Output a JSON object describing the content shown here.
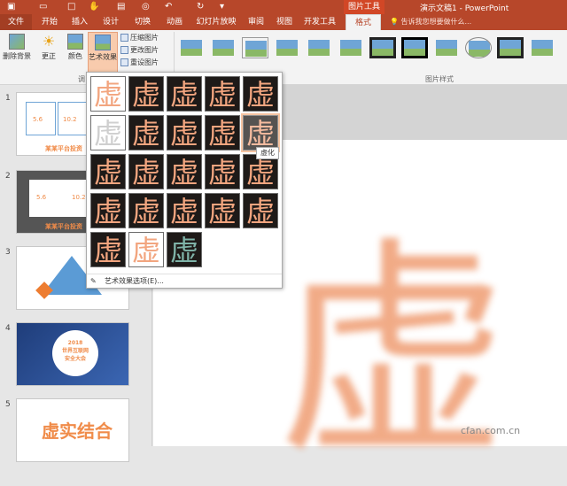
{
  "titlebar": {
    "context_tool": "图片工具",
    "doc_title": "演示文稿1 - PowerPoint"
  },
  "tabs": [
    {
      "label": "文件"
    },
    {
      "label": "开始"
    },
    {
      "label": "插入"
    },
    {
      "label": "设计"
    },
    {
      "label": "切换"
    },
    {
      "label": "动画"
    },
    {
      "label": "幻灯片放映"
    },
    {
      "label": "审阅"
    },
    {
      "label": "视图"
    },
    {
      "label": "开发工具"
    },
    {
      "label": "格式"
    }
  ],
  "tellme": "告诉我您想要做什么...",
  "ribbon": {
    "remove_bg": "删除背景",
    "corrections": "更正",
    "color": "颜色",
    "artistic": "艺术效果",
    "compress": "压缩图片",
    "change_pic": "更改图片",
    "reset_pic": "重设图片",
    "group_adjust": "调",
    "group_styles": "图片样式"
  },
  "dropdown": {
    "effect_char": "虚",
    "tooltip": "虚化",
    "options_label": "艺术效果选项(E)..."
  },
  "slides": [
    {
      "num": "1",
      "title": "某某平台投资",
      "stat1": "5.6",
      "stat2": "10.2"
    },
    {
      "num": "2",
      "title": "某某平台投资",
      "stat1": "5.6",
      "stat2": "10.2"
    },
    {
      "num": "3"
    },
    {
      "num": "4",
      "line1": "2018",
      "line2": "世界互联网",
      "line3": "安全大会"
    },
    {
      "num": "5",
      "text": "虚实结合"
    }
  ],
  "canvas": {
    "big_char": "虚"
  },
  "watermark": "cfan.com.cn",
  "colors": {
    "accent": "#b7472a",
    "effect_orange": "#f2a57f"
  }
}
